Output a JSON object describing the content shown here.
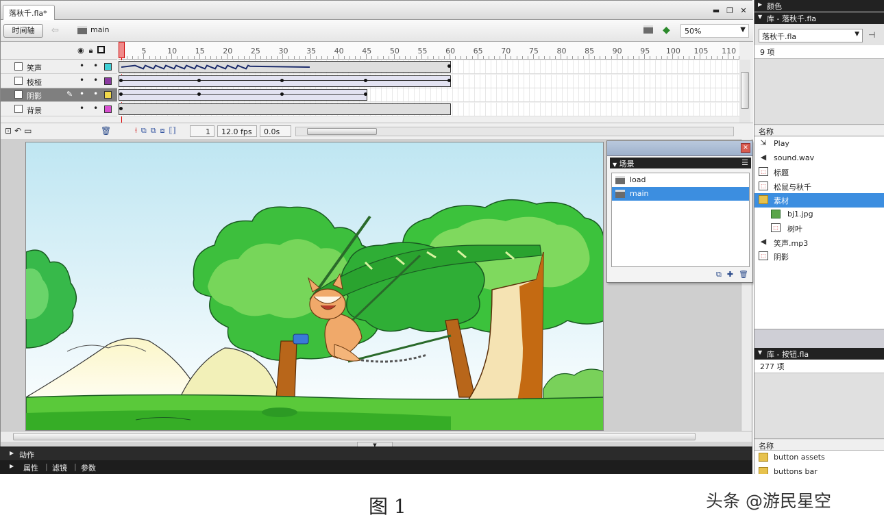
{
  "document": {
    "tab_title": "落秋千.fla*"
  },
  "edit_bar": {
    "timeline_button": "时间轴",
    "scene_name": "main",
    "zoom": "50%"
  },
  "timeline": {
    "ruler_numbers": [
      "5",
      "10",
      "15",
      "20",
      "25",
      "30",
      "35",
      "40",
      "45",
      "50",
      "55",
      "60",
      "65",
      "70",
      "75",
      "80",
      "85",
      "90",
      "95",
      "100",
      "105",
      "110"
    ],
    "layers": [
      {
        "name": "笑声",
        "color": "#3fd0d6",
        "selected": false
      },
      {
        "name": "枝桠",
        "color": "#8a3aa0",
        "selected": false
      },
      {
        "name": "阴影",
        "color": "#f1d84a",
        "selected": true
      },
      {
        "name": "背景",
        "color": "#d84fd0",
        "selected": false
      }
    ],
    "current_frame": "1",
    "frame_rate": "12.0 fps",
    "elapsed_time": "0.0s"
  },
  "scene_panel": {
    "title": "场景",
    "scenes": [
      {
        "name": "load",
        "selected": false
      },
      {
        "name": "main",
        "selected": true
      }
    ]
  },
  "bottom_panels": {
    "actions": "动作",
    "tabs": [
      "属性",
      "滤镜",
      "参数"
    ]
  },
  "right_panel": {
    "color_panel": "颜色",
    "library_header": "库 - 落秋千.fla",
    "library_select": "落秋千.fla",
    "library_count": "9 项",
    "name_column": "名称",
    "items": [
      {
        "name": "Play",
        "type": "mc",
        "child": false,
        "selected": false
      },
      {
        "name": "sound.wav",
        "type": "snd",
        "child": false,
        "selected": false
      },
      {
        "name": "标题",
        "type": "sym",
        "child": false,
        "selected": false
      },
      {
        "name": "松鼠与秋千",
        "type": "sym",
        "child": false,
        "selected": false
      },
      {
        "name": "素材",
        "type": "fld",
        "child": false,
        "selected": true
      },
      {
        "name": "bj1.jpg",
        "type": "img",
        "child": true,
        "selected": false
      },
      {
        "name": "树叶",
        "type": "sym",
        "child": true,
        "selected": false
      },
      {
        "name": "笑声.mp3",
        "type": "snd",
        "child": false,
        "selected": false
      },
      {
        "name": "阴影",
        "type": "sym",
        "child": false,
        "selected": false
      }
    ],
    "library2_header": "库 - 按钮.fla",
    "library2_count": "277 项",
    "library2_name_column": "名称",
    "library2_items": [
      "button assets",
      "buttons bar"
    ]
  },
  "caption": {
    "figure": "图 1",
    "watermark": "头条 @游民星空"
  },
  "colors": {
    "selection": "#3c8ee0",
    "playhead": "#d00000",
    "sky": "#bfe6f2",
    "grass": "#5ac93a"
  }
}
